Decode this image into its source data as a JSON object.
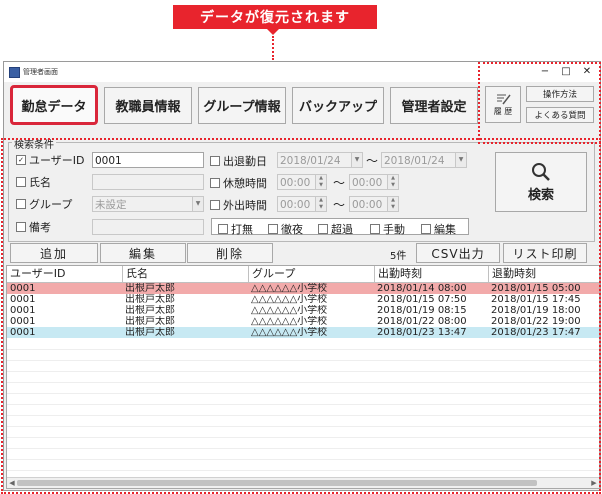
{
  "callout": "データが復元されます",
  "window": {
    "title": "管理者画面",
    "controls": {
      "minimize": "−",
      "maximize": "□",
      "close": "✕"
    }
  },
  "tabs": [
    {
      "label": "勤怠データ",
      "active": true
    },
    {
      "label": "教職員情報"
    },
    {
      "label": "グループ情報"
    },
    {
      "label": "バックアップ"
    },
    {
      "label": "管理者設定"
    }
  ],
  "side": {
    "history": "履 歴",
    "manual": "操作方法",
    "faq": "よくある質問"
  },
  "search": {
    "legend": "検索条件",
    "user_id_label": "ユーザーID",
    "user_id_value": "0001",
    "name_label": "氏名",
    "name_value": "",
    "group_label": "グループ",
    "group_value": "未設定",
    "note_label": "備考",
    "note_value": "",
    "work_date_label": "出退勤日",
    "work_date_from": "2018/01/24",
    "work_date_to": "2018/01/24",
    "break_label": "休憩時間",
    "break_from": "00:00",
    "break_to": "00:00",
    "out_label": "外出時間",
    "out_from": "00:00",
    "out_to": "00:00",
    "tilde": "〜",
    "flags": [
      "打無",
      "徹夜",
      "超過",
      "手動",
      "編集"
    ],
    "search_button": "検索"
  },
  "actions": {
    "add": "追加",
    "edit": "編集",
    "delete": "削除",
    "count": "5件",
    "csv": "CSV出力",
    "print": "リスト印刷"
  },
  "table": {
    "headers": [
      "ユーザーID",
      "氏名",
      "グループ",
      "出勤時刻",
      "退勤時刻"
    ],
    "rows": [
      {
        "id": "0001",
        "name": "出根戸太郎",
        "group": "△△△△△△小学校",
        "in": "2018/01/14 08:00",
        "out": "2018/01/15 05:00",
        "highlight": "#f2aaaa"
      },
      {
        "id": "0001",
        "name": "出根戸太郎",
        "group": "△△△△△△小学校",
        "in": "2018/01/15 07:50",
        "out": "2018/01/15 17:45",
        "highlight": ""
      },
      {
        "id": "0001",
        "name": "出根戸太郎",
        "group": "△△△△△△小学校",
        "in": "2018/01/19 08:15",
        "out": "2018/01/19 18:00",
        "highlight": ""
      },
      {
        "id": "0001",
        "name": "出根戸太郎",
        "group": "△△△△△△小学校",
        "in": "2018/01/22 08:00",
        "out": "2018/01/22 19:00",
        "highlight": ""
      },
      {
        "id": "0001",
        "name": "出根戸太郎",
        "group": "△△△△△△小学校",
        "in": "2018/01/23 13:47",
        "out": "2018/01/23 17:47",
        "highlight": "#c7e9f3"
      }
    ]
  },
  "colors": {
    "accent": "#e8242d"
  }
}
